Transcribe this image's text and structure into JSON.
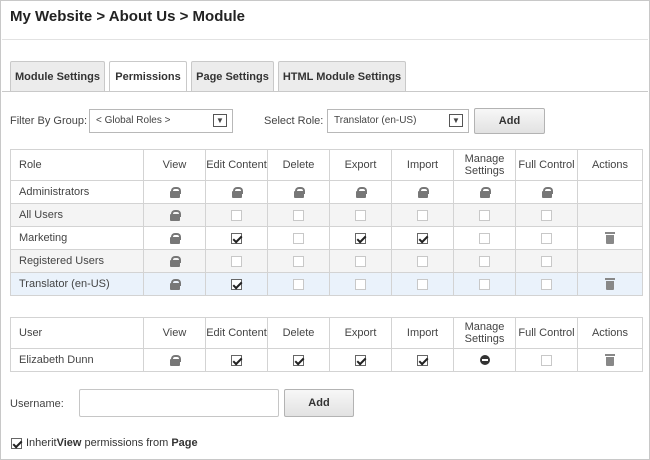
{
  "breadcrumb": "My Website > About Us > Module",
  "tabs": [
    {
      "label": "Module Settings",
      "active": false
    },
    {
      "label": "Permissions",
      "active": true
    },
    {
      "label": "Page Settings",
      "active": false
    },
    {
      "label": "HTML Module Settings",
      "active": false
    }
  ],
  "filter": {
    "group_label": "Filter By Group:",
    "group_value": "< Global Roles >",
    "role_label": "Select Role:",
    "role_value": "Translator (en-US)",
    "add_label": "Add"
  },
  "role_table": {
    "headers": [
      "Role",
      "View",
      "Edit Content",
      "Delete",
      "Export",
      "Import",
      "Manage Settings",
      "Full Control",
      "Actions"
    ],
    "rows": [
      {
        "name": "Administrators",
        "cells": [
          "lock",
          "lock",
          "lock",
          "lock",
          "lock",
          "lock",
          "lock"
        ],
        "action": ""
      },
      {
        "name": "All Users",
        "cells": [
          "lock",
          "off",
          "off",
          "off",
          "off",
          "off",
          "off"
        ],
        "action": ""
      },
      {
        "name": "Marketing",
        "cells": [
          "lock",
          "on",
          "off",
          "on",
          "on",
          "off",
          "off"
        ],
        "action": "delete"
      },
      {
        "name": "Registered Users",
        "cells": [
          "lock",
          "off",
          "off",
          "off",
          "off",
          "off",
          "off"
        ],
        "action": ""
      },
      {
        "name": "Translator (en-US)",
        "cells": [
          "lock",
          "on",
          "off",
          "off",
          "off",
          "off",
          "off"
        ],
        "action": "delete"
      }
    ]
  },
  "user_table": {
    "headers": [
      "User",
      "View",
      "Edit Content",
      "Delete",
      "Export",
      "Import",
      "Manage Settings",
      "Full Control",
      "Actions"
    ],
    "rows": [
      {
        "name": "Elizabeth Dunn",
        "cells": [
          "lock",
          "on",
          "on",
          "on",
          "on",
          "deny",
          "off"
        ],
        "action": "delete"
      }
    ]
  },
  "username": {
    "label": "Username:",
    "value": "",
    "add_label": "Add"
  },
  "inherit": {
    "checked": true,
    "prefix": "Inherit ",
    "bold1": "View",
    "middle": " permissions from ",
    "bold2": "Page"
  },
  "icons": {
    "lock": "lock-icon",
    "check": "checkbox",
    "deny": "deny-icon",
    "delete": "trash-icon",
    "dropdown": "chevron-down-icon"
  }
}
